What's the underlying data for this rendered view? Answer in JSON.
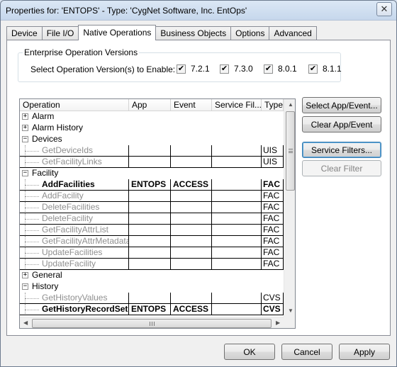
{
  "window": {
    "title": "Properties for: 'ENTOPS' - Type: 'CygNet Software, Inc. EntOps'",
    "close_glyph": "✕"
  },
  "tabs": [
    {
      "label": "Device",
      "active": false
    },
    {
      "label": "File I/O",
      "active": false
    },
    {
      "label": "Native Operations",
      "active": true
    },
    {
      "label": "Business Objects",
      "active": false
    },
    {
      "label": "Options",
      "active": false
    },
    {
      "label": "Advanced",
      "active": false
    }
  ],
  "versions": {
    "group_title": "Enterprise Operation Versions",
    "label": "Select Operation Version(s) to Enable:",
    "check_glyph": "✔",
    "items": [
      {
        "label": "7.2.1",
        "checked": true
      },
      {
        "label": "7.3.0",
        "checked": true
      },
      {
        "label": "8.0.1",
        "checked": true
      },
      {
        "label": "8.1.1",
        "checked": true
      }
    ]
  },
  "grid": {
    "columns": [
      "Operation",
      "App",
      "Event",
      "Service Fil...",
      "Type"
    ],
    "rows": [
      {
        "kind": "group",
        "expander": "+",
        "op": "Alarm"
      },
      {
        "kind": "group",
        "expander": "+",
        "op": "Alarm History"
      },
      {
        "kind": "group",
        "expander": "−",
        "op": "Devices"
      },
      {
        "kind": "item",
        "op": "GetDeviceIds",
        "app": "",
        "event": "",
        "sf": "",
        "type": "UIS",
        "bold": false
      },
      {
        "kind": "item",
        "op": "GetFacilityLinks",
        "app": "",
        "event": "",
        "sf": "",
        "type": "UIS",
        "bold": false
      },
      {
        "kind": "group",
        "expander": "−",
        "op": "Facility"
      },
      {
        "kind": "item",
        "op": "AddFacilities",
        "app": "ENTOPS",
        "event": "ACCESS",
        "sf": "",
        "type": "FAC",
        "bold": true
      },
      {
        "kind": "item",
        "op": "AddFacility",
        "app": "",
        "event": "",
        "sf": "",
        "type": "FAC",
        "bold": false
      },
      {
        "kind": "item",
        "op": "DeleteFacilities",
        "app": "",
        "event": "",
        "sf": "",
        "type": "FAC",
        "bold": false
      },
      {
        "kind": "item",
        "op": "DeleteFacility",
        "app": "",
        "event": "",
        "sf": "",
        "type": "FAC",
        "bold": false
      },
      {
        "kind": "item",
        "op": "GetFacilityAttrList",
        "app": "",
        "event": "",
        "sf": "",
        "type": "FAC",
        "bold": false
      },
      {
        "kind": "item",
        "op": "GetFacilityAttrMetadata",
        "app": "",
        "event": "",
        "sf": "",
        "type": "FAC",
        "bold": false
      },
      {
        "kind": "item",
        "op": "UpdateFacilities",
        "app": "",
        "event": "",
        "sf": "",
        "type": "FAC",
        "bold": false
      },
      {
        "kind": "item",
        "op": "UpdateFacility",
        "app": "",
        "event": "",
        "sf": "",
        "type": "FAC",
        "bold": false
      },
      {
        "kind": "group",
        "expander": "+",
        "op": "General"
      },
      {
        "kind": "group",
        "expander": "−",
        "op": "History"
      },
      {
        "kind": "item",
        "op": "GetHistoryValues",
        "app": "",
        "event": "",
        "sf": "",
        "type": "CVS",
        "bold": false
      },
      {
        "kind": "item",
        "op": "GetHistoryRecordSet",
        "app": "ENTOPS",
        "event": "ACCESS",
        "sf": "",
        "type": "CVS",
        "bold": true
      }
    ]
  },
  "side_buttons": {
    "select_app_event": "Select App/Event...",
    "clear_app_event": "Clear App/Event",
    "service_filters": "Service Filters...",
    "clear_filter": "Clear Filter"
  },
  "footer": {
    "ok": "OK",
    "cancel": "Cancel",
    "apply": "Apply"
  }
}
